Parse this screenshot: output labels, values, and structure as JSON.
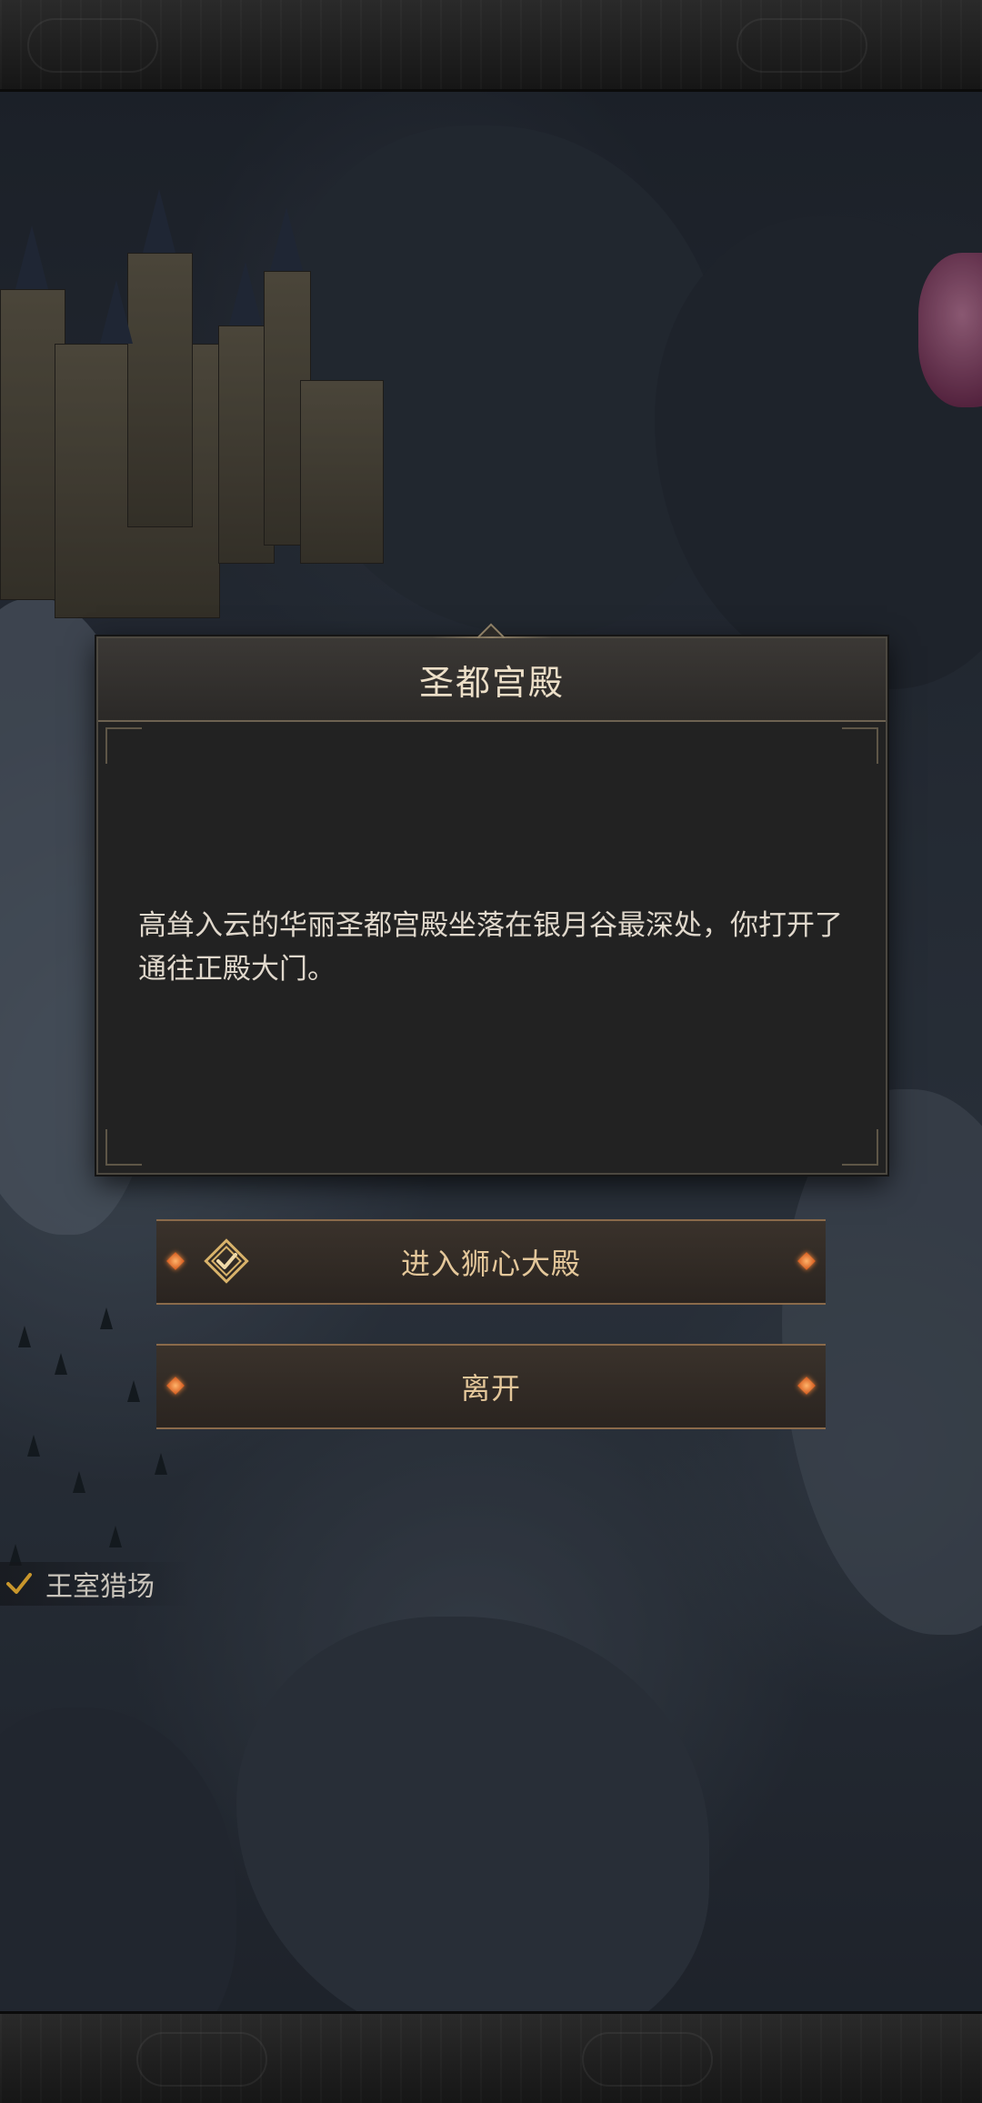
{
  "dialog": {
    "title": "圣都宫殿",
    "description": "高耸入云的华丽圣都宫殿坐落在银月谷最深处，你打开了通往正殿大门。"
  },
  "options": [
    {
      "label": "进入狮心大殿",
      "icon": "enter-check-icon"
    },
    {
      "label": "离开"
    }
  ],
  "map": {
    "location_label": "王室猎场",
    "location_icon": "check-icon"
  },
  "colors": {
    "accent_gold": "#e4c79a",
    "gem_orange": "#d2561a"
  }
}
